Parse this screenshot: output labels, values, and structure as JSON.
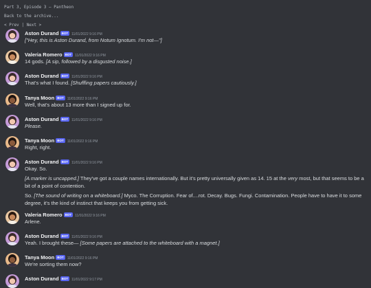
{
  "header": {
    "title": "Part 3, Episode 3 — Pantheon",
    "back_link": "Back to the archive...",
    "prev_label": "< Prev",
    "nav_separator": "|",
    "next_label": "Next >"
  },
  "badge_text": "BOT",
  "messages": [
    {
      "author": "Aston Durand",
      "timestamp": "11/01/2022 9:16 PM",
      "paragraphs": [
        [
          {
            "t": "[\"Hey, this is Aston Durand, from Notum Ignotum. I'm not—\"]",
            "i": true
          }
        ]
      ]
    },
    {
      "author": "Valeria Romero",
      "timestamp": "11/01/2022 9:16 PM",
      "paragraphs": [
        [
          {
            "t": "14 gods. ",
            "i": false
          },
          {
            "t": "[A sip, followed by a disgusted noise.]",
            "i": true
          }
        ]
      ]
    },
    {
      "author": "Aston Durand",
      "timestamp": "11/01/2022 9:16 PM",
      "paragraphs": [
        [
          {
            "t": "That's what I found. ",
            "i": false
          },
          {
            "t": "[Shuffling papers cautiously.]",
            "i": true
          }
        ]
      ]
    },
    {
      "author": "Tanya Moon",
      "timestamp": "11/01/2022 9:16 PM",
      "paragraphs": [
        [
          {
            "t": "Well, that's about 13 more than I signed up for.",
            "i": false
          }
        ]
      ]
    },
    {
      "author": "Aston Durand",
      "timestamp": "11/01/2022 9:16 PM",
      "paragraphs": [
        [
          {
            "t": "Please.",
            "i": true
          }
        ]
      ]
    },
    {
      "author": "Tanya Moon",
      "timestamp": "11/01/2022 9:16 PM",
      "paragraphs": [
        [
          {
            "t": "Right, right.",
            "i": false
          }
        ]
      ]
    },
    {
      "author": "Aston Durand",
      "timestamp": "11/01/2022 9:16 PM",
      "paragraphs": [
        [
          {
            "t": "Okay. So.",
            "i": false
          }
        ],
        [
          {
            "t": "[A marker is uncapped.]",
            "i": true
          },
          {
            "t": " They've got a couple names internationally. But it's pretty universally given as 14. 15 at the ",
            "i": false
          },
          {
            "t": "very",
            "i": true
          },
          {
            "t": " most, but that seems to be a bit of a point of contention.",
            "i": false
          }
        ],
        [
          {
            "t": "So. ",
            "i": false
          },
          {
            "t": "[The sound of writing on a whiteboard.]",
            "i": true
          },
          {
            "t": " Myco. The Corruption. Fear of....rot. Decay. Bugs. Fungi. Contamination. People have to have it to some degree, it's the kind of instinct that keeps you from getting sick.",
            "i": false
          }
        ]
      ]
    },
    {
      "author": "Valeria Romero",
      "timestamp": "11/01/2022 9:16 PM",
      "paragraphs": [
        [
          {
            "t": "Arlene.",
            "i": false
          }
        ]
      ]
    },
    {
      "author": "Aston Durand",
      "timestamp": "11/01/2022 9:16 PM",
      "paragraphs": [
        [
          {
            "t": "Yeah. I brought these— ",
            "i": false
          },
          {
            "t": "[Some papers are attached to the whiteboard with a magnet.]",
            "i": true
          }
        ]
      ]
    },
    {
      "author": "Tanya Moon",
      "timestamp": "11/01/2022 9:16 PM",
      "paragraphs": [
        [
          {
            "t": "We're sorting them now?",
            "i": false
          }
        ]
      ]
    },
    {
      "author": "Aston Durand",
      "timestamp": "11/01/2022 9:17 PM",
      "paragraphs": []
    }
  ],
  "avatars": {
    "Aston Durand": {
      "bg": "#c59bd8",
      "skin": "#f1c7b0",
      "hair": "#3a2a2a",
      "shirt": "#e4e4f0"
    },
    "Valeria Romero": {
      "bg": "#e8c6a0",
      "skin": "#c88a5e",
      "hair": "#2a1a12",
      "shirt": "#f4efe6"
    },
    "Tanya Moon": {
      "bg": "#e8b98a",
      "skin": "#8b5a3c",
      "hair": "#1e1410",
      "shirt": "#3a3040"
    }
  }
}
